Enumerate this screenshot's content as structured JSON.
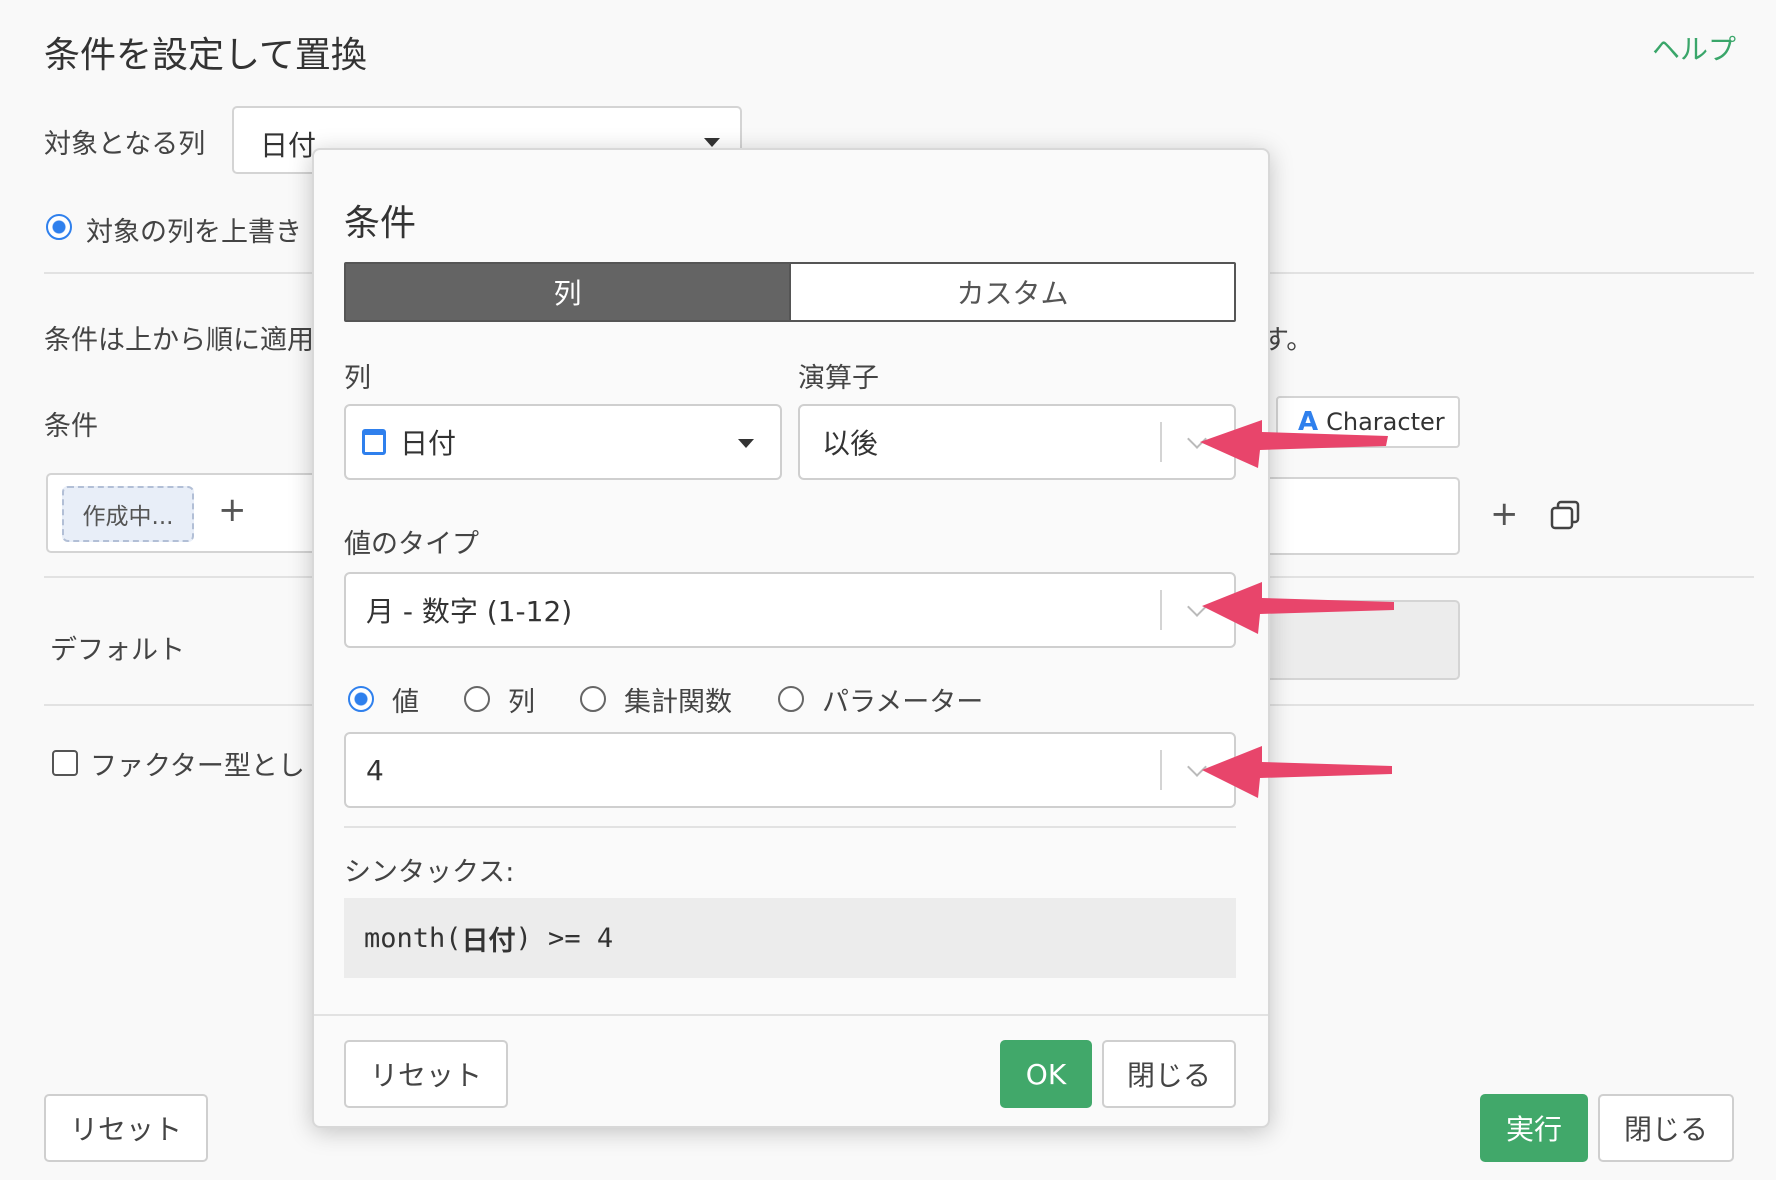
{
  "background": {
    "title": "条件を設定して置換",
    "help": "ヘルプ",
    "target_column_label": "対象となる列",
    "target_column_value": "日付",
    "overwrite_label": "対象の列を上書き",
    "info_text_left": "条件は上から順に適用",
    "info_text_right": "す。",
    "conditions_label": "条件",
    "draft_chip": "作成中...",
    "character_type": "Character",
    "default_label": "デフォルト",
    "factor_label": "ファクター型とし",
    "reset_button": "リセット",
    "run_button": "実行",
    "close_button": "閉じる"
  },
  "modal": {
    "title": "条件",
    "tabs": [
      "列",
      "カスタム"
    ],
    "column_label": "列",
    "column_value": "日付",
    "operator_label": "演算子",
    "operator_value": "以後",
    "value_type_label": "値のタイプ",
    "value_type_value": "月 - 数字 (1-12)",
    "source_options": [
      "値",
      "列",
      "集計関数",
      "パラメーター"
    ],
    "value_input": "4",
    "syntax_label": "シンタックス:",
    "syntax": {
      "prefix": "month(",
      "column": "日付",
      "suffix": ") >= 4"
    },
    "reset_button": "リセット",
    "ok_button": "OK",
    "close_button": "閉じる"
  },
  "colors": {
    "accent_green": "#41a86a",
    "arrow": "#e8456b",
    "radio_blue": "#2f80ed"
  }
}
